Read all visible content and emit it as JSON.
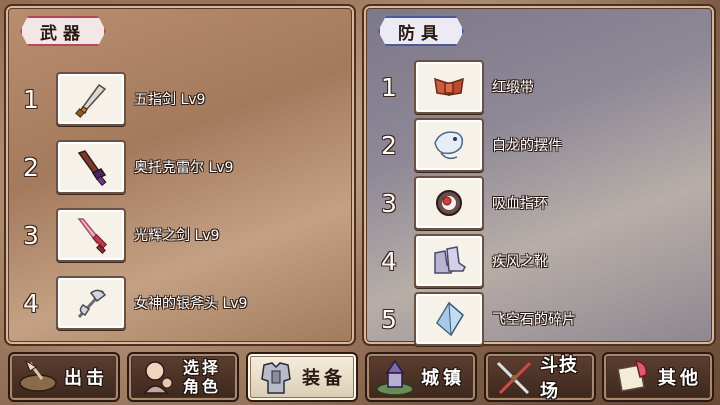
{
  "weapons": {
    "title": "武器",
    "items": [
      {
        "num": "1",
        "name": "五指剑 Lv9",
        "icon": "dagger-icon"
      },
      {
        "num": "2",
        "name": "奥托克雷尔 Lv9",
        "icon": "purple-blade-icon"
      },
      {
        "num": "3",
        "name": "光辉之剑 Lv9",
        "icon": "radiant-sword-icon"
      },
      {
        "num": "4",
        "name": "女神的银斧头 Lv9",
        "icon": "silver-axe-icon"
      }
    ]
  },
  "armor": {
    "title": "防具",
    "items": [
      {
        "num": "1",
        "name": "红缎带",
        "icon": "red-ribbon-icon"
      },
      {
        "num": "2",
        "name": "白龙的摆件",
        "icon": "white-dragon-ornament-icon"
      },
      {
        "num": "3",
        "name": "吸血指环",
        "icon": "vampire-ring-icon"
      },
      {
        "num": "4",
        "name": "疾风之靴",
        "icon": "gale-boots-icon"
      },
      {
        "num": "5",
        "name": "飞空石的碎片",
        "icon": "skystone-shard-icon"
      }
    ]
  },
  "menu": {
    "sortie": {
      "label": "出击",
      "icon": "airship-icon"
    },
    "select_character": {
      "label_line1": "选择",
      "label_line2": "角色",
      "icon": "character-portrait-icon"
    },
    "equipment": {
      "label": "装备",
      "icon": "armor-icon",
      "active": true
    },
    "town": {
      "label": "城镇",
      "icon": "castle-icon"
    },
    "arena": {
      "label": "斗技场",
      "icon": "crossed-swords-icon"
    },
    "other": {
      "label": "其他",
      "icon": "scroll-quill-icon"
    }
  },
  "colors": {
    "weapons_title_border": "#b34a5a",
    "armor_title_border": "#4d5b9c",
    "active_button": "#f6efdf"
  }
}
